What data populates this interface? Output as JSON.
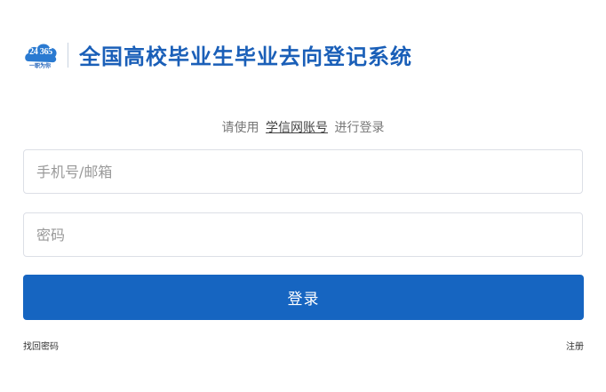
{
  "header": {
    "logo_text": "24 365",
    "logo_subtext": "一职为你",
    "title": "全国高校毕业生毕业去向登记系统"
  },
  "login_hint": {
    "prefix": "请使用",
    "account_link": "学信网账号",
    "suffix": "进行登录"
  },
  "form": {
    "account_placeholder": "手机号/邮箱",
    "account_value": "",
    "password_placeholder": "密码",
    "password_value": "",
    "login_label": "登录"
  },
  "links": {
    "forgot_password": "找回密码",
    "register": "注册"
  },
  "colors": {
    "brand": "#1a5fb8",
    "button": "#1665c1",
    "border": "#dcdfe6"
  }
}
